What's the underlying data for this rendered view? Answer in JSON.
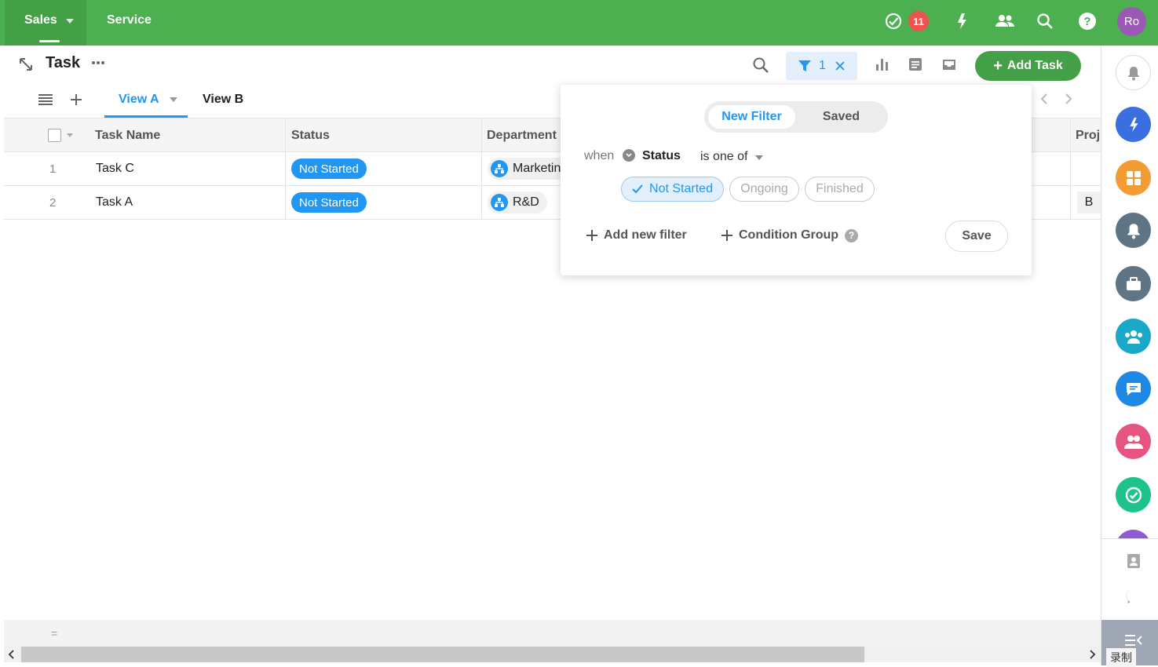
{
  "topbar": {
    "sales_label": "Sales",
    "service_label": "Service",
    "notification_count": "11",
    "avatar_initials": "Ro",
    "icons": [
      "check-circle-icon",
      "spark-icon",
      "people-icon",
      "search-icon",
      "help-icon"
    ]
  },
  "header": {
    "title": "Task",
    "filter_count": "1",
    "add_task_label": "Add Task"
  },
  "views": {
    "tabs": [
      {
        "label": "View A",
        "active": true
      },
      {
        "label": "View B",
        "active": false
      }
    ]
  },
  "table": {
    "columns": [
      "Task Name",
      "Status",
      "Department",
      "Proj"
    ],
    "rows": [
      {
        "num": "1",
        "task": "Task C",
        "status": "Not Started",
        "department": "Marketing",
        "project": ""
      },
      {
        "num": "2",
        "task": "Task A",
        "status": "Not Started",
        "department": "R&D",
        "project": "B"
      }
    ]
  },
  "filter_popup": {
    "tab_new": "New Filter",
    "tab_saved": "Saved",
    "when": "when",
    "field": "Status",
    "operator": "is one of",
    "options": [
      {
        "label": "Not Started",
        "selected": true
      },
      {
        "label": "Ongoing",
        "selected": false
      },
      {
        "label": "Finished",
        "selected": false
      }
    ],
    "add_new_filter": "Add new filter",
    "condition_group": "Condition Group",
    "help": "?",
    "save": "Save"
  },
  "footer": {
    "equals": "=",
    "record_label": "录制"
  },
  "colors": {
    "topbar": "#4caf50",
    "accent": "#2196f3",
    "primary_button": "#43a047"
  }
}
